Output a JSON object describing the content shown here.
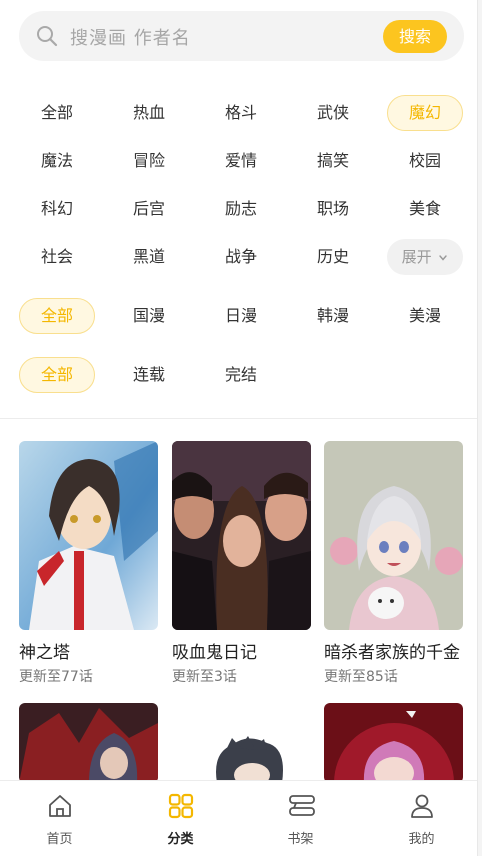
{
  "search": {
    "placeholder": "搜漫画 作者名",
    "button": "搜索"
  },
  "genres": [
    [
      "全部",
      "热血",
      "格斗",
      "武侠",
      "魔幻"
    ],
    [
      "魔法",
      "冒险",
      "爱情",
      "搞笑",
      "校园"
    ],
    [
      "科幻",
      "后宫",
      "励志",
      "职场",
      "美食"
    ],
    [
      "社会",
      "黑道",
      "战争",
      "历史",
      "展开"
    ]
  ],
  "genre_active": "魔幻",
  "regions": [
    "全部",
    "国漫",
    "日漫",
    "韩漫",
    "美漫"
  ],
  "region_active": "全部",
  "status": [
    "全部",
    "连载",
    "完结"
  ],
  "status_active": "全部",
  "comics": [
    {
      "title": "神之塔",
      "update": "更新至77话"
    },
    {
      "title": "吸血鬼日记",
      "update": "更新至3话"
    },
    {
      "title": "暗杀者家族的千金",
      "update": "更新至85话"
    }
  ],
  "tabbar": [
    "首页",
    "分类",
    "书架",
    "我的"
  ],
  "colors": {
    "accent": "#fcc51f",
    "accent_text": "#f4b700"
  },
  "icons": [
    "search-icon",
    "chevron-down-icon",
    "home-icon",
    "category-icon",
    "bookshelf-icon",
    "user-icon"
  ]
}
